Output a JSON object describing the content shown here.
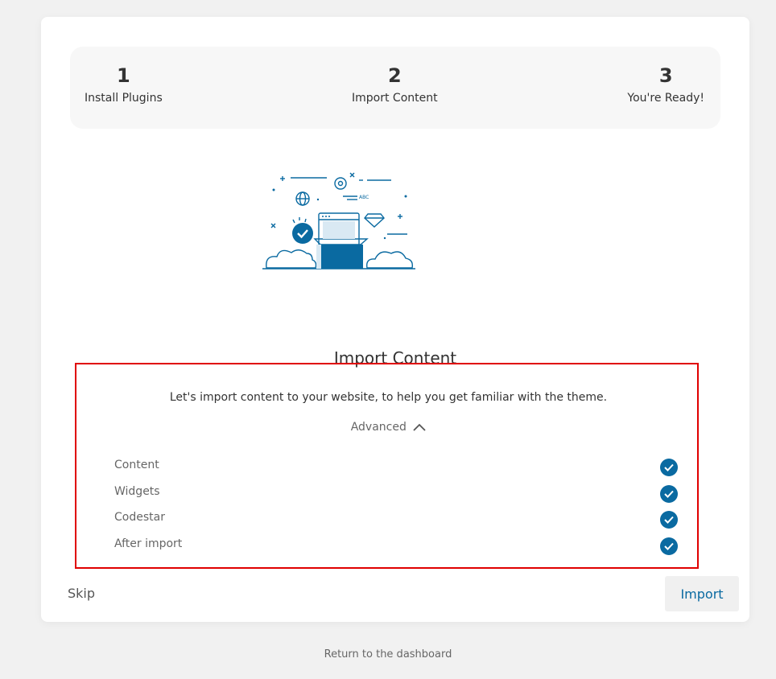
{
  "steps": [
    {
      "number": "1",
      "label": "Install Plugins"
    },
    {
      "number": "2",
      "label": "Import Content"
    },
    {
      "number": "3",
      "label": "You're Ready!"
    }
  ],
  "illustration": {
    "badge_text": "ABC"
  },
  "main": {
    "title": "Import Content",
    "description": "Let's import content to your website, to help you get familiar with the theme.",
    "advanced_label": "Advanced",
    "options": [
      {
        "label": "Content",
        "checked": true
      },
      {
        "label": "Widgets",
        "checked": true
      },
      {
        "label": "Codestar",
        "checked": true
      },
      {
        "label": "After import",
        "checked": true
      }
    ]
  },
  "footer": {
    "skip_label": "Skip",
    "import_label": "Import",
    "return_label": "Return to the dashboard"
  },
  "colors": {
    "accent": "#0a6aa1",
    "highlight_border": "#e00000"
  }
}
